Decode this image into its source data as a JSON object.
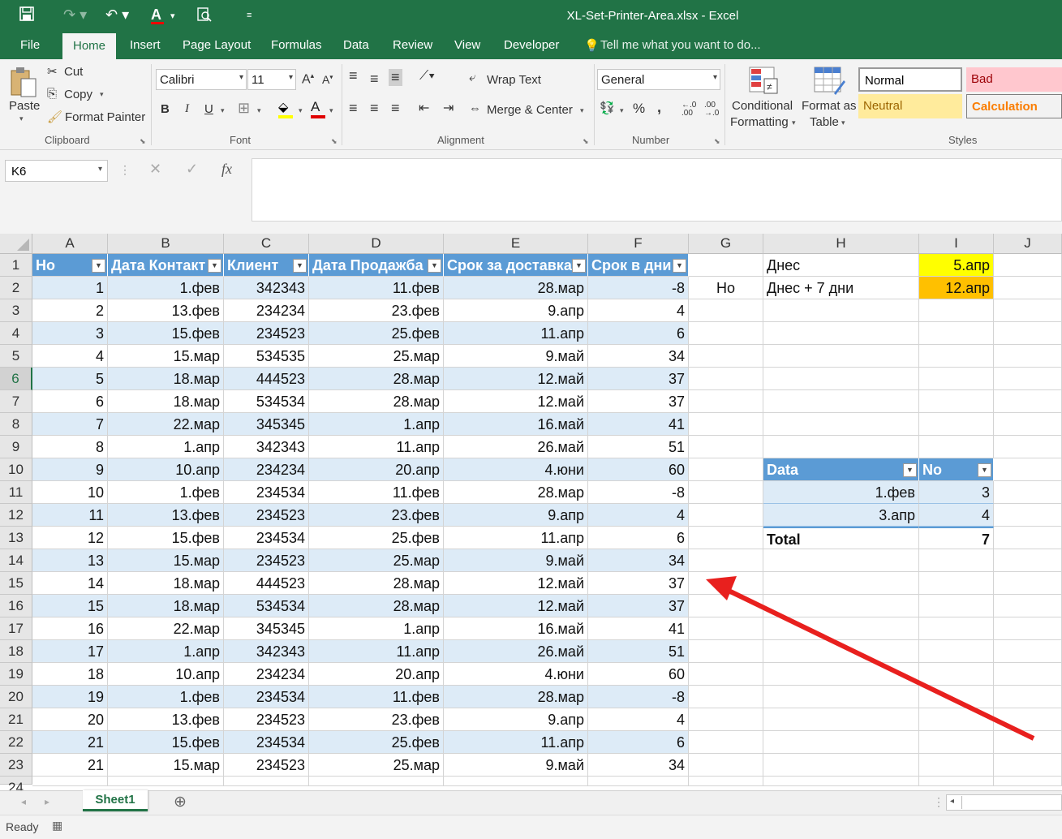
{
  "window": {
    "title": "XL-Set-Printer-Area.xlsx - Excel"
  },
  "menu_tabs": [
    "File",
    "Home",
    "Insert",
    "Page Layout",
    "Formulas",
    "Data",
    "Review",
    "View",
    "Developer"
  ],
  "tell_me": "Tell me what you want to do...",
  "clipboard": {
    "paste": "Paste",
    "cut": "Cut",
    "copy": "Copy",
    "format_painter": "Format Painter",
    "group": "Clipboard"
  },
  "font": {
    "name": "Calibri",
    "size": "11",
    "group": "Font",
    "bold": "B",
    "italic": "I",
    "underline": "U"
  },
  "alignment": {
    "wrap": "Wrap Text",
    "merge": "Merge & Center",
    "group": "Alignment"
  },
  "number": {
    "format": "General",
    "percent": "%",
    "comma": ",",
    "inc": "←.0 .00",
    "group": "Number"
  },
  "styles_group": {
    "cond1": "Conditional",
    "cond2": "Formatting",
    "fmt1": "Format as",
    "fmt2": "Table",
    "group": "Styles",
    "normal": "Normal",
    "bad": "Bad",
    "neutral": "Neutral",
    "calculation": "Calculation"
  },
  "name_box": "K6",
  "fx_label": "fx",
  "columns": [
    "A",
    "B",
    "C",
    "D",
    "E",
    "F",
    "G",
    "H",
    "I",
    "J"
  ],
  "table": {
    "headers": [
      "Но",
      "Дата Контакт",
      "Клиент",
      "Дата Продажба",
      "Срок за доставка",
      "Срок в дни"
    ],
    "rows": [
      [
        "1",
        "1.фев",
        "342343",
        "11.фев",
        "28.мар",
        "-8"
      ],
      [
        "2",
        "13.фев",
        "234234",
        "23.фев",
        "9.апр",
        "4"
      ],
      [
        "3",
        "15.фев",
        "234523",
        "25.фев",
        "11.апр",
        "6"
      ],
      [
        "4",
        "15.мар",
        "534535",
        "25.мар",
        "9.май",
        "34"
      ],
      [
        "5",
        "18.мар",
        "444523",
        "28.мар",
        "12.май",
        "37"
      ],
      [
        "6",
        "18.мар",
        "534534",
        "28.мар",
        "12.май",
        "37"
      ],
      [
        "7",
        "22.мар",
        "345345",
        "1.апр",
        "16.май",
        "41"
      ],
      [
        "8",
        "1.апр",
        "342343",
        "11.апр",
        "26.май",
        "51"
      ],
      [
        "9",
        "10.апр",
        "234234",
        "20.апр",
        "4.юни",
        "60"
      ],
      [
        "10",
        "1.фев",
        "234534",
        "11.фев",
        "28.мар",
        "-8"
      ],
      [
        "11",
        "13.фев",
        "234523",
        "23.фев",
        "9.апр",
        "4"
      ],
      [
        "12",
        "15.фев",
        "234534",
        "25.фев",
        "11.апр",
        "6"
      ],
      [
        "13",
        "15.мар",
        "234523",
        "25.мар",
        "9.май",
        "34"
      ],
      [
        "14",
        "18.мар",
        "444523",
        "28.мар",
        "12.май",
        "37"
      ],
      [
        "15",
        "18.мар",
        "534534",
        "28.мар",
        "12.май",
        "37"
      ],
      [
        "16",
        "22.мар",
        "345345",
        "1.апр",
        "16.май",
        "41"
      ],
      [
        "17",
        "1.апр",
        "342343",
        "11.апр",
        "26.май",
        "51"
      ],
      [
        "18",
        "10.апр",
        "234234",
        "20.апр",
        "4.юни",
        "60"
      ],
      [
        "19",
        "1.фев",
        "234534",
        "11.фев",
        "28.мар",
        "-8"
      ],
      [
        "20",
        "13.фев",
        "234523",
        "23.фев",
        "9.апр",
        "4"
      ],
      [
        "21",
        "15.фев",
        "234534",
        "25.фев",
        "11.апр",
        "6"
      ],
      [
        "21",
        "15.мар",
        "234523",
        "25.мар",
        "9.май",
        "34"
      ]
    ]
  },
  "side": {
    "g2": "Но",
    "h1": "Днес",
    "i1": "5.апр",
    "h2": "Днес + 7 дни",
    "i2": "12.апр"
  },
  "pivot": {
    "headers": [
      "Data",
      "No"
    ],
    "rows": [
      [
        "1.фев",
        "3"
      ],
      [
        "3.апр",
        "4"
      ]
    ],
    "total_label": "Total",
    "total_value": "7"
  },
  "sheet_tab": "Sheet1",
  "status": "Ready",
  "colors": {
    "excel_green": "#217346",
    "table_header": "#5b9bd5",
    "band": "#ddebf7",
    "today": "#ffff00",
    "plus7": "#ffc000",
    "arrow": "#e8201e"
  }
}
